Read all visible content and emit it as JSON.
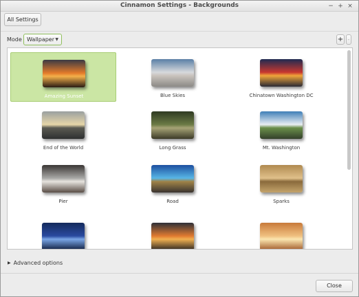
{
  "window": {
    "title": "Cinnamon Settings - Backgrounds",
    "controls": [
      "−",
      "+",
      "×"
    ]
  },
  "toolbar": {
    "all_settings_label": "All Settings"
  },
  "mode": {
    "label": "Mode",
    "selected": "Wallpaper",
    "add_label": "+",
    "remove_label": "-"
  },
  "wallpapers": [
    {
      "name": "Amazing Sunset",
      "selected": true,
      "colors": [
        "#3a3a44",
        "#e27a2a",
        "#f4b04a",
        "#2b1d14"
      ]
    },
    {
      "name": "Blue Skies",
      "selected": false,
      "colors": [
        "#5a7fa6",
        "#d7d9dc",
        "#c9c3bd",
        "#8c8a86"
      ]
    },
    {
      "name": "Chinatown Washington DC",
      "selected": false,
      "colors": [
        "#1f2b52",
        "#c8372f",
        "#f0a53a",
        "#2a2a35"
      ]
    },
    {
      "name": "End of the World",
      "selected": false,
      "colors": [
        "#9aa0a0",
        "#e6d6a8",
        "#5a5a52",
        "#2e3030"
      ]
    },
    {
      "name": "Long Grass",
      "selected": false,
      "colors": [
        "#2f3a22",
        "#6b7a45",
        "#a6a376",
        "#3c3a28"
      ]
    },
    {
      "name": "Mt. Washington",
      "selected": false,
      "colors": [
        "#3f7fb8",
        "#e9eef2",
        "#6a8f4a",
        "#33402a"
      ]
    },
    {
      "name": "Pier",
      "selected": false,
      "colors": [
        "#3a3634",
        "#a8a8a6",
        "#e6e3de",
        "#5a4e46"
      ]
    },
    {
      "name": "Road",
      "selected": false,
      "colors": [
        "#1d4fa0",
        "#58b6e6",
        "#a08348",
        "#3a3430"
      ]
    },
    {
      "name": "Sparks",
      "selected": false,
      "colors": [
        "#b08a50",
        "#e0c08a",
        "#8a6a3c",
        "#c4a46c"
      ]
    },
    {
      "name": "",
      "selected": false,
      "colors": [
        "#142a5c",
        "#2a4aa0",
        "#7aa6e6",
        "#0e1c3c"
      ]
    },
    {
      "name": "",
      "selected": false,
      "colors": [
        "#2e3038",
        "#e07a30",
        "#f0b050",
        "#2a2420"
      ]
    },
    {
      "name": "",
      "selected": false,
      "colors": [
        "#c87a3a",
        "#f0c080",
        "#fbe6b0",
        "#a05a2a"
      ]
    }
  ],
  "advanced": {
    "label": "Advanced options"
  },
  "footer": {
    "close_label": "Close"
  },
  "scroll": {
    "position": 0.0,
    "visible_fraction": 0.61
  }
}
